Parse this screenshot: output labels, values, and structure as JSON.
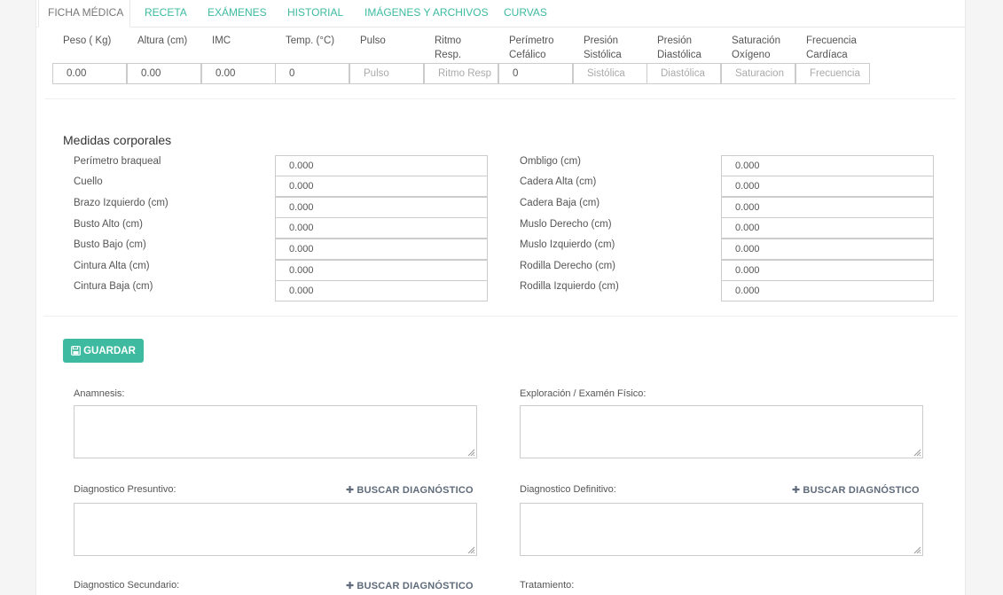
{
  "tabs": [
    "FICHA MÉDICA",
    "RECETA",
    "EXÁMENES",
    "HISTORIAL",
    "IMÁGENES Y ARCHIVOS",
    "CURVAS"
  ],
  "vitals": [
    {
      "label_line1": "Peso ( Kg)",
      "label_line2": "",
      "value": "0.00",
      "placeholder": ""
    },
    {
      "label_line1": "Altura (cm)",
      "label_line2": "",
      "value": "0.00",
      "placeholder": ""
    },
    {
      "label_line1": "IMC",
      "label_line2": "",
      "value": "0.00",
      "placeholder": ""
    },
    {
      "label_line1": "Temp. (°C)",
      "label_line2": "",
      "value": "0",
      "placeholder": ""
    },
    {
      "label_line1": "Pulso",
      "label_line2": "",
      "value": "",
      "placeholder": "Pulso"
    },
    {
      "label_line1": "Ritmo",
      "label_line2": "Resp.",
      "value": "",
      "placeholder": "Ritmo Resp"
    },
    {
      "label_line1": "Perímetro",
      "label_line2": "Cefálico",
      "value": "0",
      "placeholder": ""
    },
    {
      "label_line1": "Presión",
      "label_line2": "Sistólica",
      "value": "",
      "placeholder": "Sistólica"
    },
    {
      "label_line1": "Presión",
      "label_line2": "Diastólica",
      "value": "",
      "placeholder": "Diastólica"
    },
    {
      "label_line1": "Saturación",
      "label_line2": "Oxígeno",
      "value": "",
      "placeholder": "Saturacion"
    },
    {
      "label_line1": "Frecuencia",
      "label_line2": "Cardíaca",
      "value": "",
      "placeholder": "Frecuencia"
    }
  ],
  "body_measures": {
    "title": "Medidas corporales",
    "left": [
      {
        "label": "Perímetro braqueal",
        "value": "0.000"
      },
      {
        "label": "Cuello",
        "value": "0.000"
      },
      {
        "label": "Brazo Izquierdo (cm)",
        "value": "0.000"
      },
      {
        "label": "Busto Alto (cm)",
        "value": "0.000"
      },
      {
        "label": "Busto Bajo (cm)",
        "value": "0.000"
      },
      {
        "label": "Cintura Alta (cm)",
        "value": "0.000"
      },
      {
        "label": "Cintura Baja (cm)",
        "value": "0.000"
      }
    ],
    "right": [
      {
        "label": "Ombligo (cm)",
        "value": "0.000"
      },
      {
        "label": "Cadera Alta (cm)",
        "value": "0.000"
      },
      {
        "label": "Cadera Baja (cm)",
        "value": "0.000"
      },
      {
        "label": "Muslo Derecho (cm)",
        "value": "0.000"
      },
      {
        "label": "Muslo Izquierdo (cm)",
        "value": "0.000"
      },
      {
        "label": "Rodilla Derecho (cm)",
        "value": "0.000"
      },
      {
        "label": "Rodilla Izquierdo (cm)",
        "value": "0.000"
      }
    ]
  },
  "save_button": {
    "label": "GUARDAR",
    "icon": "floppy-disk-icon"
  },
  "fields": {
    "anamnesis": "Anamnesis:",
    "exploracion": "Exploración / Examén Físico:",
    "diag_presuntivo": "Diagnostico Presuntivo:",
    "diag_definitivo": "Diagnostico Definitivo:",
    "diag_secundario": "Diagnostico Secundario:",
    "tratamiento": "Tratamiento:",
    "search_link": "BUSCAR DIAGNÓSTICO"
  },
  "colors": {
    "accent": "#3dbaa0",
    "link": "#5f6b7a"
  }
}
